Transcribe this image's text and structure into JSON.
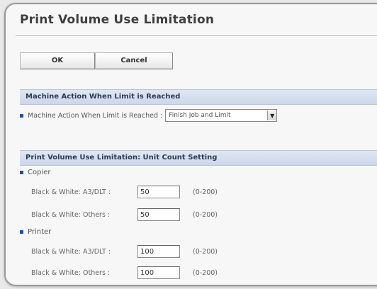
{
  "header": {
    "title": "Print Volume Use Limitation"
  },
  "toolbar": {
    "ok_label": "OK",
    "cancel_label": "Cancel"
  },
  "machine_action": {
    "section_title": "Machine Action When Limit is Reached",
    "label": "Machine Action When Limit is Reached :",
    "selected": "Finish Job and Limit"
  },
  "unit_count": {
    "section_title": "Print Volume Use Limitation: Unit Count Setting",
    "copier": {
      "label": "Copier",
      "bw_a3": {
        "label": "Black & White: A3/DLT :",
        "value": "50",
        "range": "(0-200)"
      },
      "bw_others": {
        "label": "Black & White: Others :",
        "value": "50",
        "range": "(0-200)"
      }
    },
    "printer": {
      "label": "Printer",
      "bw_a3": {
        "label": "Black & White: A3/DLT :",
        "value": "100",
        "range": "(0-200)"
      },
      "bw_others": {
        "label": "Black & White: Others :",
        "value": "100",
        "range": "(0-200)"
      }
    }
  },
  "colors": {
    "accent": "#2a4f9a",
    "section_bg": "#d6deef"
  }
}
